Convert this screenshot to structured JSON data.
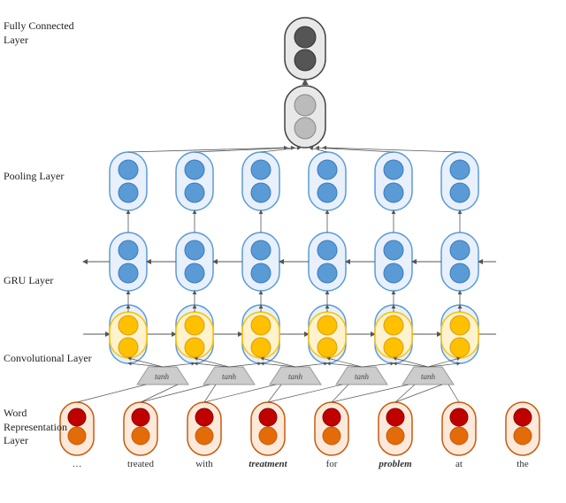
{
  "labels": {
    "fully_connected": "Fully Connected\nLayer",
    "pooling": "Pooling Layer",
    "gru": "GRU Layer",
    "convolutional": "Convolutional Layer",
    "word_representation": "Word Representation\nLayer"
  },
  "words": [
    "…",
    "treated",
    "with",
    "treatment",
    "for",
    "problem",
    "at",
    "the",
    "…"
  ],
  "tanh_labels": [
    "tanh",
    "tanh",
    "tanh",
    "tanh",
    "tanh"
  ],
  "colors": {
    "dark_gray": "#555",
    "light_gray": "#bbb",
    "blue": "#5b9bd5",
    "yellow": "#ffc000",
    "orange": "#e36c09",
    "red": "#c00000",
    "outline": "#333"
  }
}
